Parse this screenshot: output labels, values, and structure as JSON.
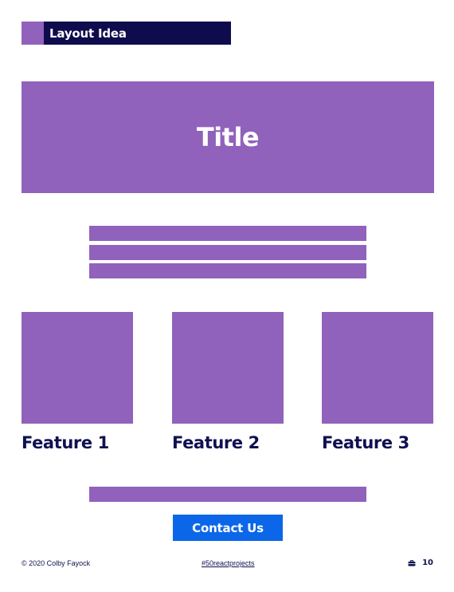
{
  "header": {
    "title": "Layout Idea"
  },
  "hero": {
    "title": "Title"
  },
  "features": [
    {
      "label": "Feature 1"
    },
    {
      "label": "Feature 2"
    },
    {
      "label": "Feature 3"
    }
  ],
  "contact": {
    "label": "Contact Us"
  },
  "footer": {
    "copyright": "© 2020 Colby Fayock",
    "hashtag": "#50reactprojects",
    "page_number": "10",
    "icon": "briefcase-icon"
  },
  "colors": {
    "navy": "#0f0c4d",
    "purple": "#9062bb",
    "blue": "#0b67e8",
    "white": "#ffffff"
  }
}
